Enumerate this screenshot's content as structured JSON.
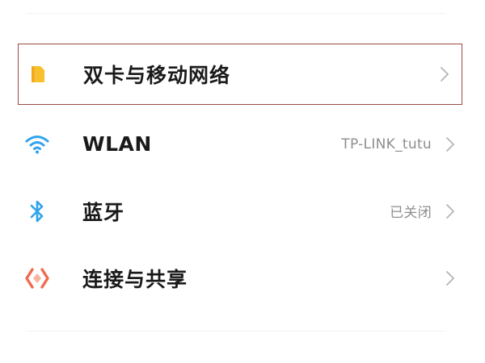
{
  "items": [
    {
      "id": "sim",
      "label": "双卡与移动网络",
      "value": "",
      "icon": "sim-card-icon",
      "icon_color": "#f7c02c",
      "selected": true
    },
    {
      "id": "wlan",
      "label": "WLAN",
      "value": "TP-LINK_tutu",
      "icon": "wifi-icon",
      "icon_color": "#2fa3ec"
    },
    {
      "id": "bluetooth",
      "label": "蓝牙",
      "value": "已关闭",
      "icon": "bluetooth-icon",
      "icon_color": "#2fa3ec"
    },
    {
      "id": "share",
      "label": "连接与共享",
      "value": "",
      "icon": "connection-sharing-icon",
      "icon_color": "#f06a4f"
    }
  ],
  "colors": {
    "selection_border": "#9b4a44",
    "chevron": "#b5b5b5"
  }
}
